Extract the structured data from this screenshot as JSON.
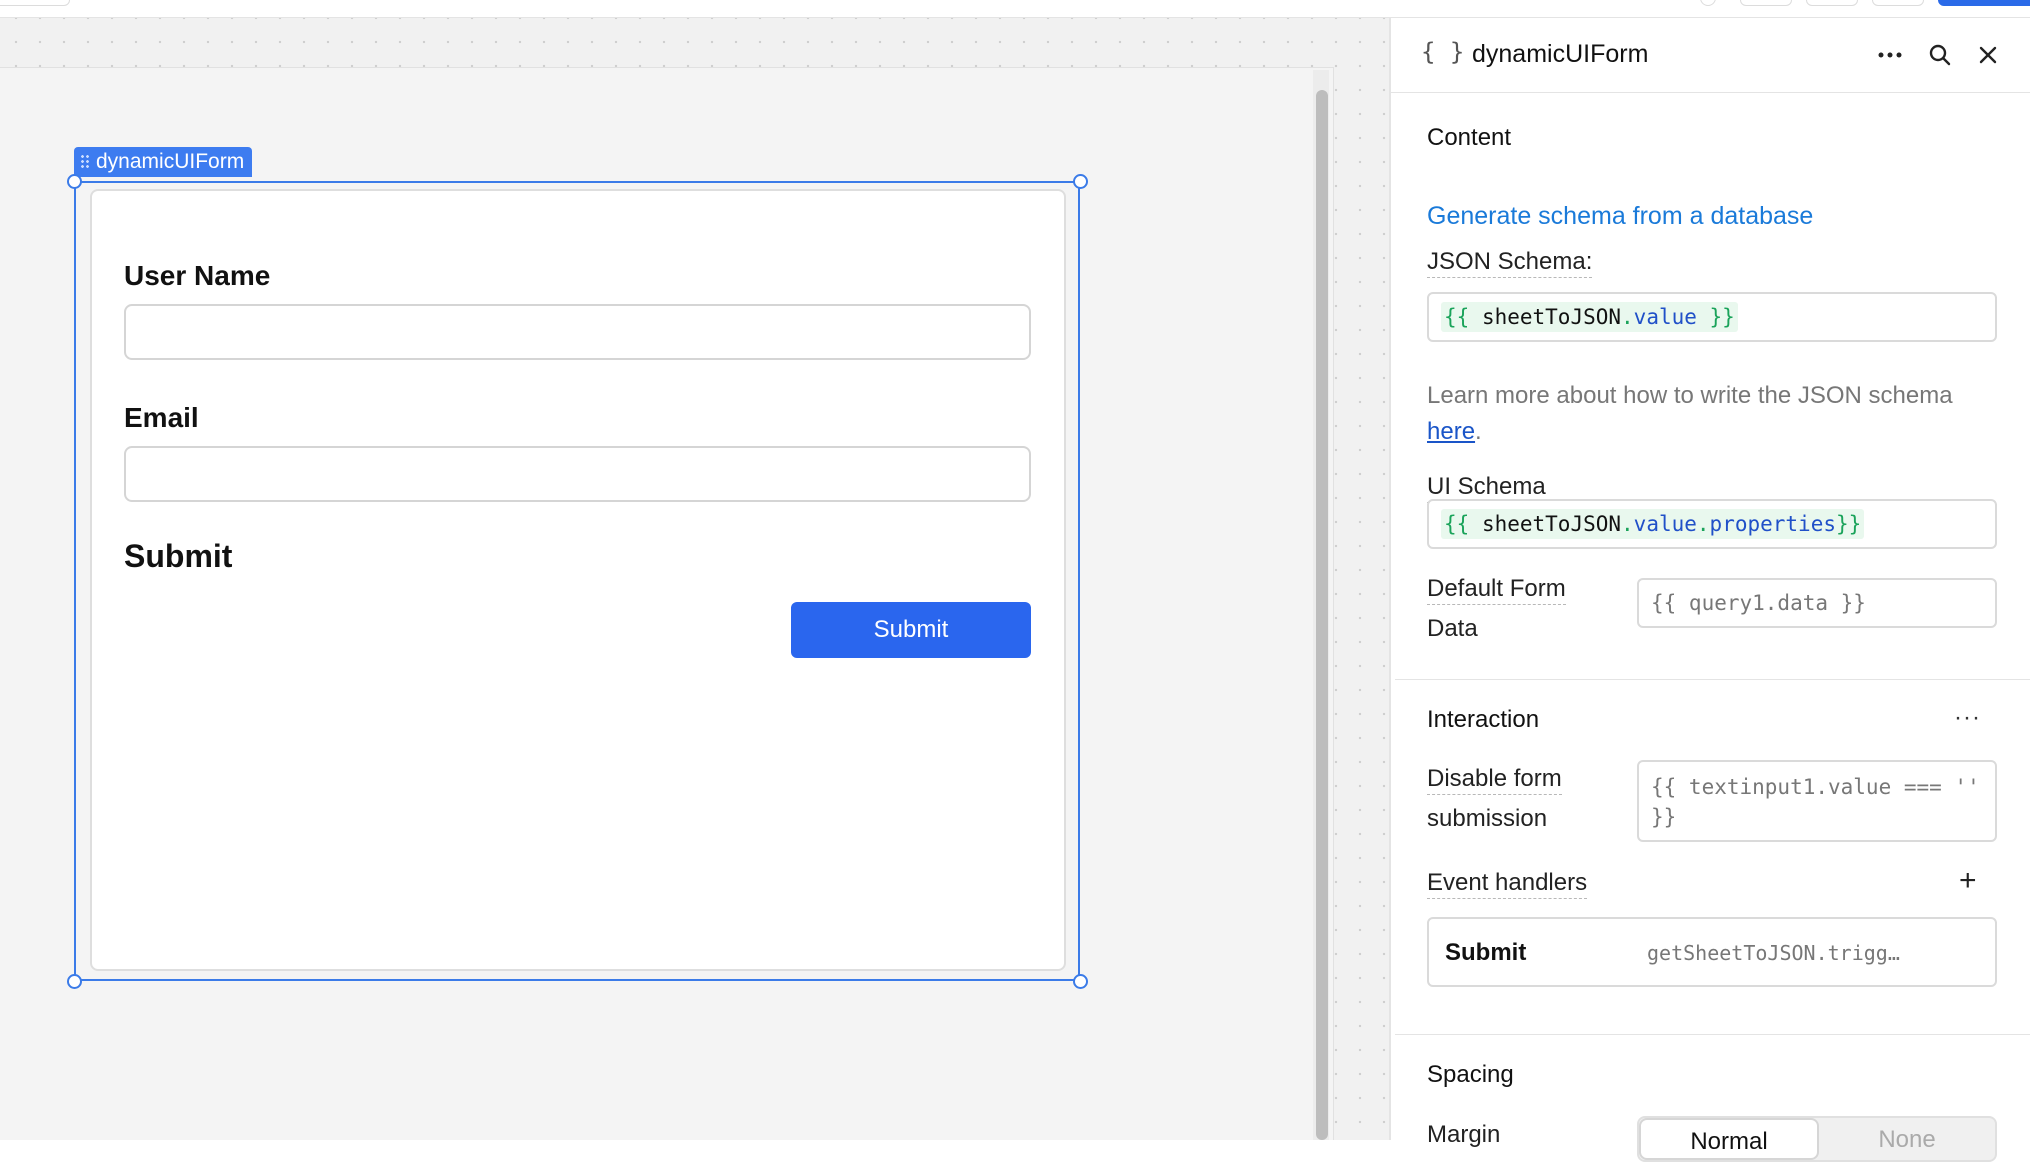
{
  "canvas": {
    "selected_component": "dynamicUIForm",
    "form": {
      "fields": [
        {
          "label": "User Name",
          "value": ""
        },
        {
          "label": "Email",
          "value": ""
        }
      ],
      "heading": "Submit",
      "submit_label": "Submit"
    }
  },
  "inspector": {
    "component_icon": "{ }",
    "component_name": "dynamicUIForm",
    "content": {
      "title": "Content",
      "generate_link": "Generate schema from a database",
      "json_schema_label": "JSON Schema:",
      "json_schema_value": "{{ sheetToJSON.value }}",
      "json_schema_tokens": {
        "open": "{{ ",
        "ident": "sheetToJSON",
        "dot": ".",
        "prop": "value",
        "close": " }}"
      },
      "help_text": "Learn more about how to write the JSON schema",
      "help_link": "here",
      "help_suffix": ".",
      "ui_schema_label": "UI Schema",
      "ui_schema_value": "{{ sheetToJSON.value.properties}}",
      "ui_schema_tokens": {
        "open": "{{ ",
        "ident": "sheetToJSON",
        "dot1": ".",
        "prop1": "value",
        "dot2": ".",
        "prop2": "properties",
        "close": "}}"
      },
      "default_form_data_label_line1": "Default Form",
      "default_form_data_label_line2": "Data",
      "default_form_data_value": "{{ query1.data }}"
    },
    "interaction": {
      "title": "Interaction",
      "more_glyph": "···",
      "disable_label_line1": "Disable form",
      "disable_label_line2": "submission",
      "disable_value": "{{ textinput1.value === '' }}",
      "event_handlers_label": "Event handlers",
      "add_glyph": "+",
      "handlers": [
        {
          "event": "Submit",
          "action": "getSheetToJSON.trigg…"
        }
      ]
    },
    "spacing": {
      "title": "Spacing",
      "margin_label": "Margin",
      "margin_options": [
        "Normal",
        "None"
      ],
      "margin_selected": "Normal"
    }
  },
  "icons": {
    "header_more": "more-horizontal-icon",
    "header_search": "search-icon",
    "header_close": "close-icon",
    "drag": "drag-handle-icon"
  },
  "colors": {
    "accent": "#2a66ee",
    "selection": "#3b7be8",
    "link": "#1a7ad9",
    "code_brace": "#1aa35a",
    "code_prop": "#2050c8"
  }
}
